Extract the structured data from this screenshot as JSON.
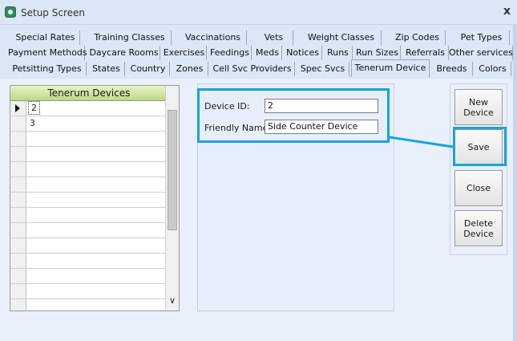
{
  "window": {
    "title": "Setup Screen",
    "close_glyph": "x"
  },
  "tabs": {
    "row1": [
      "Special Rates",
      "Training Classes",
      "Vaccinations",
      "Vets",
      "Weight Classes",
      "Zip Codes",
      "Pet Types"
    ],
    "row2": [
      "Payment Methods",
      "Daycare Rooms",
      "Exercises",
      "Feedings",
      "Meds",
      "Notices",
      "Runs",
      "Run Sizes",
      "Referrals",
      "Other services"
    ],
    "row3": [
      "Petsitting Types",
      "States",
      "Country",
      "Zones",
      "Cell Svc Providers",
      "Spec Svcs",
      "Tenerum Device",
      "Breeds",
      "Colors"
    ],
    "active": "Tenerum Device"
  },
  "grid": {
    "header": "Tenerum Devices",
    "rows": [
      "2",
      "3",
      "",
      "",
      "",
      "",
      "",
      "",
      "",
      "",
      "",
      "",
      "",
      ""
    ],
    "selected_index": 0
  },
  "form": {
    "device_id_label": "Device ID:",
    "device_id_value": "2",
    "friendly_name_label": "Friendly Name",
    "friendly_name_value": "Side Counter Device"
  },
  "buttons": {
    "new_device": "New Device",
    "save": "Save",
    "close": "Close",
    "delete_device": "Delete Device"
  },
  "colors": {
    "highlight": "#1aa3d6",
    "grid_header": "#b8d98a"
  }
}
